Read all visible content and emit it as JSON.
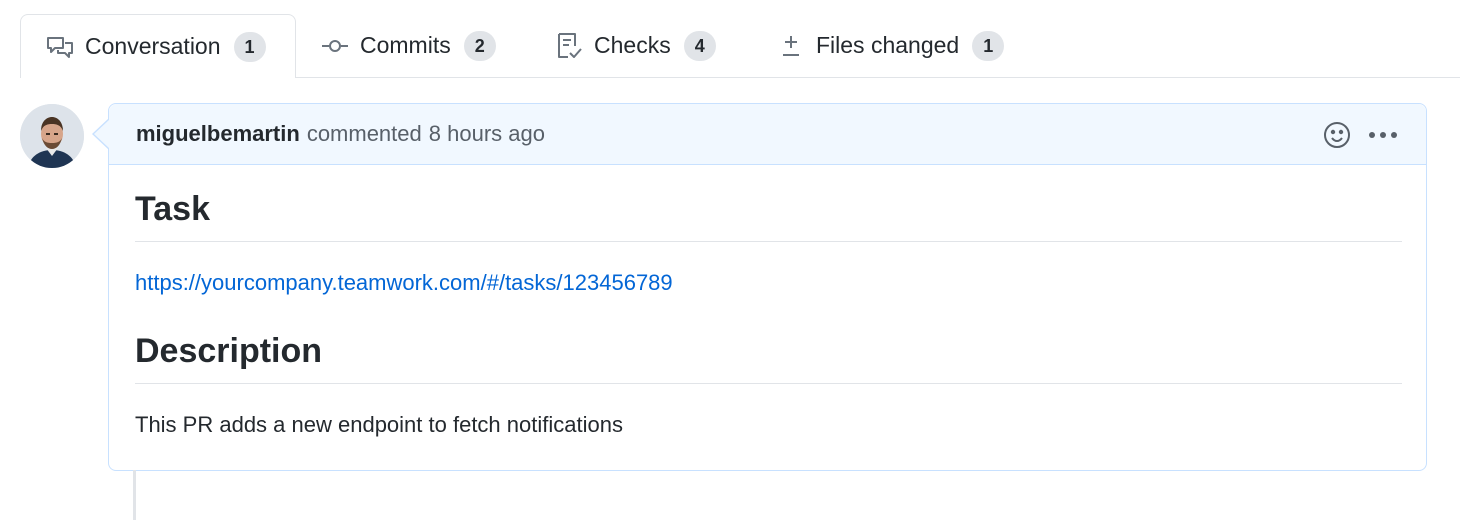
{
  "tabs": [
    {
      "label": "Conversation",
      "count": "1",
      "icon": "comment-discussion-icon",
      "selected": true
    },
    {
      "label": "Commits",
      "count": "2",
      "icon": "git-commit-icon",
      "selected": false
    },
    {
      "label": "Checks",
      "count": "4",
      "icon": "checklist-icon",
      "selected": false
    },
    {
      "label": "Files changed",
      "count": "1",
      "icon": "diff-icon",
      "selected": false
    }
  ],
  "comment": {
    "author": "miguelbemartin",
    "action": "commented",
    "time": "8 hours ago",
    "actions": [
      "smiley-icon",
      "kebab-horizontal-icon"
    ],
    "sections": {
      "task_heading": "Task",
      "task_link": "https://yourcompany.teamwork.com/#/tasks/123456789",
      "description_heading": "Description",
      "description_text": "This PR adds a new endpoint to fetch notifications"
    }
  },
  "colors": {
    "link": "#0366d6",
    "header_bg": "#f1f8ff",
    "header_border": "#c8e1ff",
    "counter_bg": "#e1e4e8"
  }
}
